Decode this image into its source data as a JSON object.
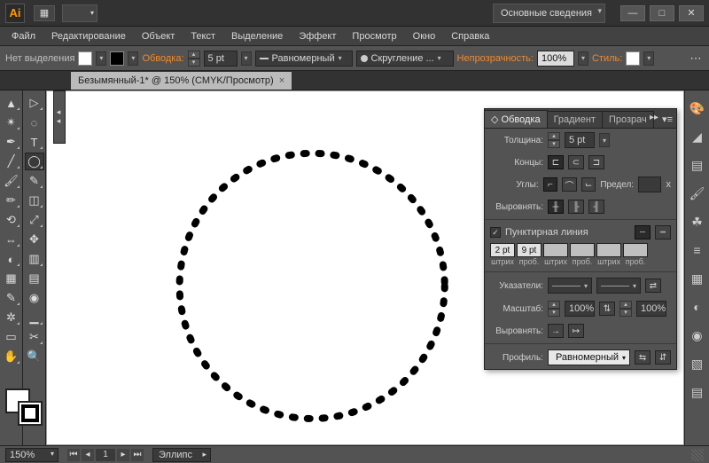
{
  "app": {
    "logo": "Ai",
    "workspace": "Основные сведения"
  },
  "winbtns": {
    "min": "—",
    "max": "□",
    "close": "✕"
  },
  "menu": [
    "Файл",
    "Редактирование",
    "Объект",
    "Текст",
    "Выделение",
    "Эффект",
    "Просмотр",
    "Окно",
    "Справка"
  ],
  "ctrl": {
    "selection": "Нет выделения",
    "stroke_label": "Обводка:",
    "stroke_val": "5 pt",
    "stroke_profile": "Равномерный",
    "brush_label": "Скругление ...",
    "opacity_label": "Непрозрачность:",
    "opacity_val": "100%",
    "style_label": "Стиль:"
  },
  "doc": {
    "title": "Безымянный-1* @ 150% (CMYK/Просмотр)"
  },
  "panel": {
    "tabs": [
      "Обводка",
      "Градиент",
      "Прозрач"
    ],
    "weight_label": "Толщина:",
    "weight_val": "5 pt",
    "caps_label": "Концы:",
    "corner_label": "Углы:",
    "limit_label": "Предел:",
    "limit_unit": "x",
    "align_label": "Выровнять:",
    "dashed_label": "Пунктирная линия",
    "dash_vals": [
      "2 pt",
      "9 pt",
      "",
      "",
      "",
      ""
    ],
    "dash_headers": [
      "штрих",
      "проб.",
      "штрих",
      "проб.",
      "штрих",
      "проб."
    ],
    "arrows_label": "Указатели:",
    "scale_label": "Масштаб:",
    "scale_a": "100%",
    "scale_b": "100%",
    "alignarr_label": "Выровнять:",
    "profile_label": "Профиль:",
    "profile_val": "Равномерный"
  },
  "status": {
    "zoom": "150%",
    "page": "1",
    "tool": "Эллипс"
  }
}
